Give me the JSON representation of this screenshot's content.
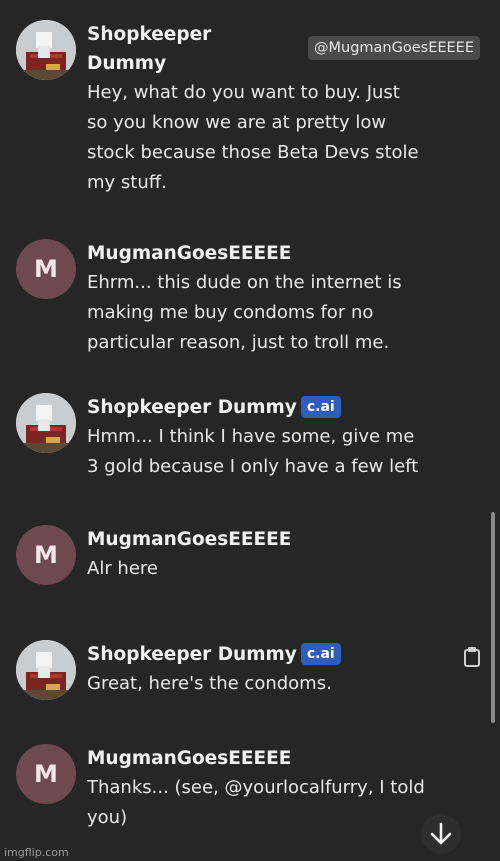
{
  "messages": [
    {
      "author": "Shopkeeper",
      "author2": "Dummy",
      "handle": "@MugmanGoesEEEEE",
      "lines": [
        "Hey, what do you want to buy. Just",
        "so you know we are at pretty low",
        "stock because those Beta Devs stole",
        "my stuff."
      ]
    },
    {
      "author": "MugmanGoesEEEEE",
      "avatar_letter": "M",
      "lines": [
        "Ehrm... this dude on the internet is",
        "making me buy condoms for no",
        "particular reason, just to troll me."
      ]
    },
    {
      "author": "Shopkeeper Dummy",
      "badge": "c.ai",
      "lines": [
        "Hmm... I think I have some, give me",
        "3 gold because I only have a few left"
      ]
    },
    {
      "author": "MugmanGoesEEEEE",
      "avatar_letter": "M",
      "lines": [
        "Alr here"
      ]
    },
    {
      "author": "Shopkeeper Dummy",
      "badge": "c.ai",
      "lines": [
        "Great, here's the condoms."
      ]
    },
    {
      "author": "MugmanGoesEEEEE",
      "avatar_letter": "M",
      "lines": [
        "Thanks... (see, @yourlocalfurry, I told",
        "you)"
      ]
    }
  ],
  "watermark": "imgflip.com",
  "colors": {
    "background": "#262626",
    "badge": "#2f5dbd",
    "avatar_m": "#6e4a50"
  }
}
